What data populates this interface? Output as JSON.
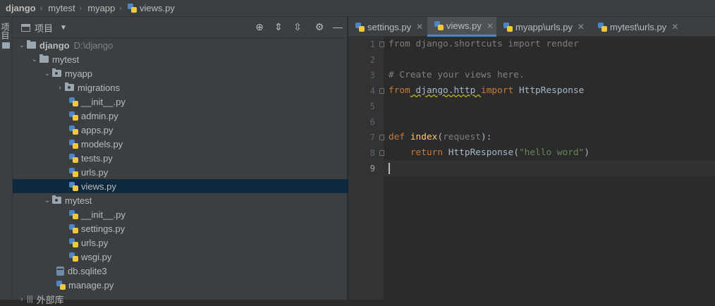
{
  "breadcrumb": {
    "items": [
      "django",
      "mytest",
      "myapp",
      "views.py"
    ]
  },
  "left_strip": {
    "label": "项目"
  },
  "project_panel": {
    "title": "项目",
    "toolbar_icons": [
      "locate-icon",
      "expand-all-icon",
      "collapse-all-icon",
      "gear-icon",
      "minimize-icon"
    ],
    "tree": [
      {
        "label": "django",
        "path": "D:\\django",
        "type": "folder",
        "bold": true
      },
      {
        "label": "mytest",
        "type": "folder"
      },
      {
        "label": "myapp",
        "type": "package"
      },
      {
        "label": "migrations",
        "type": "package"
      },
      {
        "label": "__init__.py",
        "type": "python"
      },
      {
        "label": "admin.py",
        "type": "python"
      },
      {
        "label": "apps.py",
        "type": "python"
      },
      {
        "label": "models.py",
        "type": "python"
      },
      {
        "label": "tests.py",
        "type": "python"
      },
      {
        "label": "urls.py",
        "type": "python"
      },
      {
        "label": "views.py",
        "type": "python",
        "selected": true
      },
      {
        "label": "mytest",
        "type": "package"
      },
      {
        "label": "__init__.py",
        "type": "python"
      },
      {
        "label": "settings.py",
        "type": "python"
      },
      {
        "label": "urls.py",
        "type": "python"
      },
      {
        "label": "wsgi.py",
        "type": "python"
      },
      {
        "label": "db.sqlite3",
        "type": "database"
      },
      {
        "label": "manage.py",
        "type": "python"
      },
      {
        "label": "外部库",
        "type": "library"
      }
    ]
  },
  "editor": {
    "tabs": [
      {
        "label": "settings.py",
        "active": false
      },
      {
        "label": "views.py",
        "active": true
      },
      {
        "label": "myapp\\urls.py",
        "active": false
      },
      {
        "label": "mytest\\urls.py",
        "active": false
      }
    ],
    "line_numbers": [
      "1",
      "2",
      "3",
      "4",
      "5",
      "6",
      "7",
      "8",
      "9"
    ],
    "lines": {
      "l1": {
        "kw1": "from",
        "mod": " django.shortcuts ",
        "kw2": "import",
        "rest": " render"
      },
      "l3": {
        "comment": "# Create your views here."
      },
      "l4": {
        "kw1": "from",
        "mod": " django.http ",
        "kw2": "import",
        "rest": " HttpResponse"
      },
      "l7": {
        "kw": "def ",
        "fn": "index",
        "open": "(",
        "param": "request",
        "close": "):"
      },
      "l8": {
        "indent": "    ",
        "kw": "return",
        "call": " HttpResponse(",
        "str": "\"hello word\"",
        "close": ")"
      }
    },
    "current_line": "9"
  }
}
